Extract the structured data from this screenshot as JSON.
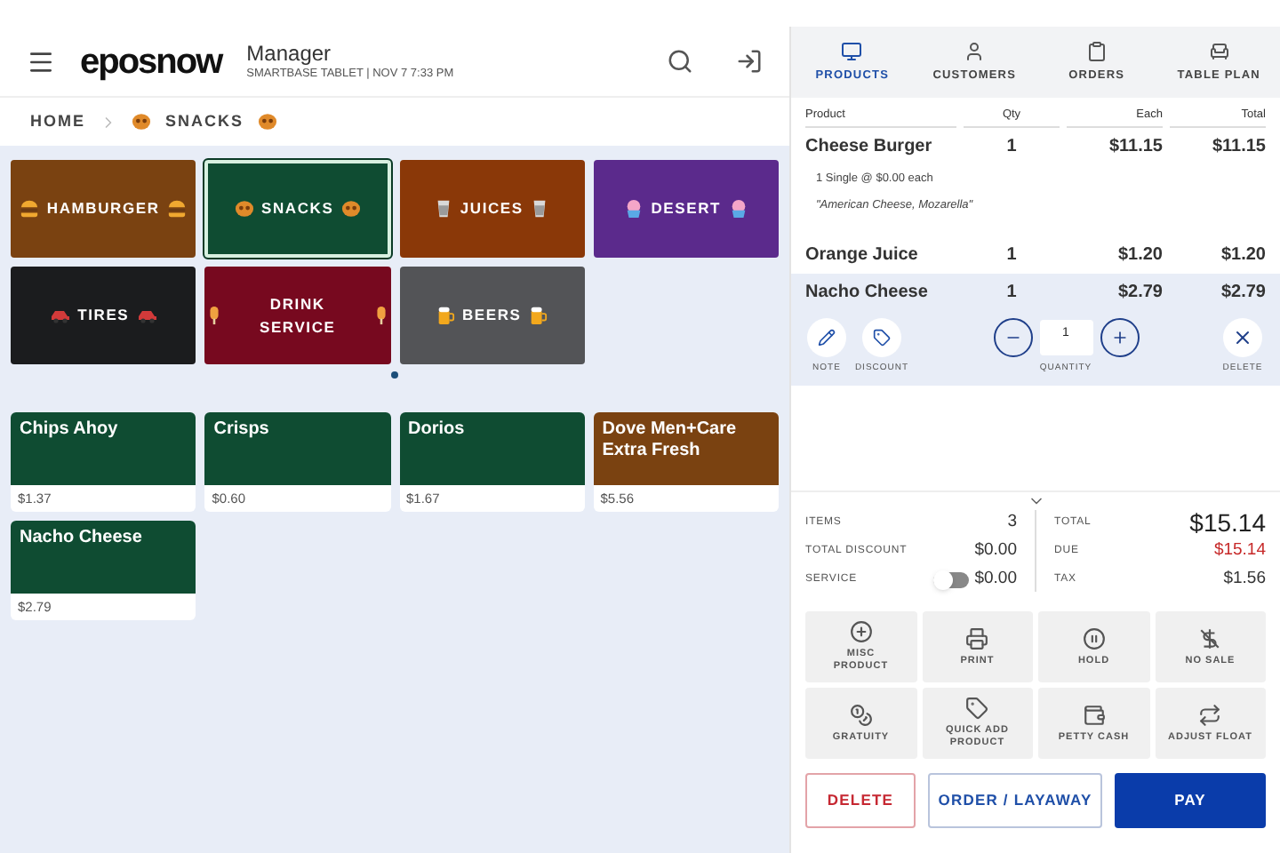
{
  "header": {
    "logo": "eposnow",
    "user": "Manager",
    "subtitle": "SMARTBASE TABLET | NOV 7 7:33 PM"
  },
  "breadcrumb": [
    {
      "label": "HOME"
    },
    {
      "label": "SNACKS",
      "kind": "pretzel"
    }
  ],
  "categories": [
    {
      "label": "HAMBURGER",
      "kind": "burger",
      "color": "#7a4211",
      "selected": false
    },
    {
      "label": "SNACKS",
      "kind": "pretzel",
      "color": "#0f4c32",
      "selected": true
    },
    {
      "label": "JUICES",
      "kind": "cup",
      "color": "#8a3808",
      "selected": false
    },
    {
      "label": "DESERT",
      "kind": "cupcake",
      "color": "#5b2a8c",
      "selected": false
    },
    {
      "label": "TIRES",
      "kind": "car",
      "color": "#1b1c1e",
      "selected": false
    },
    {
      "label": "DRINK SERVICE",
      "kind": "popsicle",
      "color": "#77091f",
      "selected": false
    },
    {
      "label": "BEERS",
      "kind": "beer",
      "color": "#535457",
      "selected": false
    }
  ],
  "products": [
    {
      "name": "Chips Ahoy",
      "price": "$1.37",
      "color": "#0f4c32"
    },
    {
      "name": "Crisps",
      "price": "$0.60",
      "color": "#0f4c32"
    },
    {
      "name": "Dorios",
      "price": "$1.67",
      "color": "#0f4c32"
    },
    {
      "name": "Dove Men+Care Extra Fresh",
      "price": "$5.56",
      "color": "#7a4211"
    },
    {
      "name": "Nacho Cheese",
      "price": "$2.79",
      "color": "#0f4c32"
    }
  ],
  "tabs": [
    {
      "label": "PRODUCTS",
      "kind": "monitor",
      "selected": true
    },
    {
      "label": "CUSTOMERS",
      "kind": "user",
      "selected": false
    },
    {
      "label": "ORDERS",
      "kind": "clipboard",
      "selected": false
    },
    {
      "label": "TABLE PLAN",
      "kind": "chair",
      "selected": false
    }
  ],
  "order": {
    "columns": [
      "Product",
      "Qty",
      "Each",
      "Total"
    ],
    "rows": [
      {
        "product": "Cheese Burger",
        "qty": "1",
        "each": "$11.15",
        "total": "$11.15",
        "selected": false,
        "modifier": "1 Single @ $0.00 each",
        "note": "\"American Cheese, Mozarella\""
      },
      {
        "product": "Orange Juice",
        "qty": "1",
        "each": "$1.20",
        "total": "$1.20",
        "selected": false
      },
      {
        "product": "Nacho Cheese",
        "qty": "1",
        "each": "$2.79",
        "total": "$2.79",
        "selected": true
      }
    ],
    "actions": {
      "note": "NOTE",
      "discount": "DISCOUNT",
      "quantity": "1",
      "quantity_label": "QUANTITY",
      "delete": "DELETE"
    }
  },
  "summary": {
    "left": [
      {
        "label": "ITEMS",
        "value": "3"
      },
      {
        "label": "TOTAL DISCOUNT",
        "value": "$0.00"
      },
      {
        "label": "SERVICE",
        "value": "$0.00",
        "kind": "toggle",
        "on": false
      }
    ],
    "right": [
      {
        "label": "TOTAL",
        "value": "$15.14",
        "kind": "big"
      },
      {
        "label": "DUE",
        "value": "$15.14",
        "kind": "due"
      },
      {
        "label": "TAX",
        "value": "$1.56",
        "kind": "plain"
      }
    ]
  },
  "functions": [
    {
      "label": "MISC PRODUCT",
      "kind": "plus"
    },
    {
      "label": "PRINT",
      "kind": "print"
    },
    {
      "label": "HOLD",
      "kind": "pause"
    },
    {
      "label": "NO SALE",
      "kind": "nosale"
    },
    {
      "label": "GRATUITY",
      "kind": "coins"
    },
    {
      "label": "QUICK ADD PRODUCT",
      "kind": "tag"
    },
    {
      "label": "PETTY CASH",
      "kind": "wallet"
    },
    {
      "label": "ADJUST FLOAT",
      "kind": "swap"
    }
  ],
  "buttons": [
    {
      "label": "DELETE",
      "kind": "danger"
    },
    {
      "label": "ORDER / LAYAWAY",
      "kind": "outline"
    },
    {
      "label": "PAY",
      "kind": "primary"
    }
  ]
}
